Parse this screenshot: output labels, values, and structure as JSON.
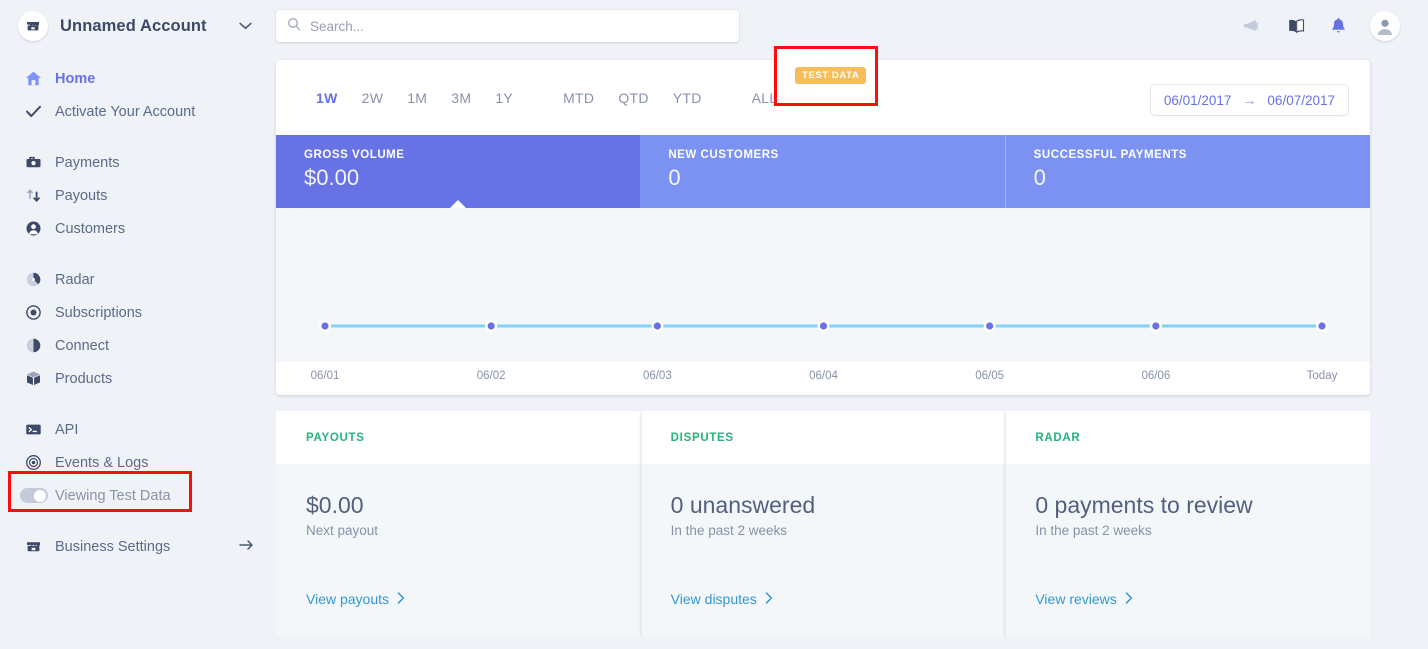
{
  "topbar": {
    "account_name": "Unnamed Account",
    "account_icon": "store-icon",
    "chevron_icon": "chevron-down-icon",
    "search_placeholder": "Search...",
    "search_value": "",
    "icons": [
      "megaphone-icon",
      "book-icon",
      "bell-icon",
      "avatar-icon"
    ]
  },
  "sidebar": {
    "items": [
      {
        "label": "Home",
        "icon": "home-icon",
        "active": true
      },
      {
        "label": "Activate Your Account",
        "icon": "check-icon",
        "active": false
      },
      {
        "label": "Payments",
        "icon": "payments-icon",
        "active": false
      },
      {
        "label": "Payouts",
        "icon": "payouts-icon",
        "active": false
      },
      {
        "label": "Customers",
        "icon": "customers-icon",
        "active": false
      },
      {
        "label": "Radar",
        "icon": "radar-icon",
        "active": false
      },
      {
        "label": "Subscriptions",
        "icon": "subscriptions-icon",
        "active": false
      },
      {
        "label": "Connect",
        "icon": "connect-icon",
        "active": false
      },
      {
        "label": "Products",
        "icon": "products-icon",
        "active": false
      },
      {
        "label": "API",
        "icon": "api-icon",
        "active": false
      },
      {
        "label": "Events & Logs",
        "icon": "events-logs-icon",
        "active": false
      }
    ],
    "test_data_toggle": {
      "label": "Viewing Test Data",
      "icon": "toggle-icon",
      "state": "on"
    },
    "business_settings": {
      "label": "Business Settings",
      "icon": "store-icon",
      "arrow": "arrow-right-icon"
    }
  },
  "test_badge": {
    "label": "TEST DATA",
    "color": "#f5be58"
  },
  "chart_panel": {
    "ranges": [
      {
        "label": "1W",
        "active": true
      },
      {
        "label": "2W",
        "active": false
      },
      {
        "label": "1M",
        "active": false
      },
      {
        "label": "3M",
        "active": false
      },
      {
        "label": "1Y",
        "active": false
      },
      {
        "label": "MTD",
        "active": false
      },
      {
        "label": "QTD",
        "active": false
      },
      {
        "label": "YTD",
        "active": false
      },
      {
        "label": "ALL",
        "active": false
      }
    ],
    "date_range": {
      "start": "06/01/2017",
      "arrow": "→",
      "end": "06/07/2017"
    },
    "metrics": [
      {
        "label": "GROSS VOLUME",
        "value": "$0.00",
        "selected": true
      },
      {
        "label": "NEW CUSTOMERS",
        "value": "0",
        "selected": false
      },
      {
        "label": "SUCCESSFUL PAYMENTS",
        "value": "0",
        "selected": false
      }
    ]
  },
  "chart_data": {
    "type": "line",
    "title": "Gross Volume",
    "x": [
      "06/01",
      "06/02",
      "06/03",
      "06/04",
      "06/05",
      "06/06",
      "Today"
    ],
    "values": [
      0,
      0,
      0,
      0,
      0,
      0,
      0
    ],
    "ylabel": "",
    "xlabel": "",
    "ylim": [
      0,
      1
    ],
    "grid": false,
    "legend": "none",
    "line_color": "#7fd3f7",
    "point_color": "#6772e5"
  },
  "bottom_cards": [
    {
      "header": "PAYOUTS",
      "big": "$0.00",
      "sub": "Next payout",
      "link": "View payouts",
      "link_icon": "chevron-right-icon"
    },
    {
      "header": "DISPUTES",
      "big": "0 unanswered",
      "sub": "In the past 2 weeks",
      "link": "View disputes",
      "link_icon": "chevron-right-icon"
    },
    {
      "header": "RADAR",
      "big": "0 payments to review",
      "sub": "In the past 2 weeks",
      "link": "View reviews",
      "link_icon": "chevron-right-icon"
    }
  ],
  "colors": {
    "accent": "#6772e5",
    "metric_inactive": "#7b92f2",
    "green": "#24b47e",
    "link": "#3297d3",
    "annotation": "#fd0d0d"
  }
}
